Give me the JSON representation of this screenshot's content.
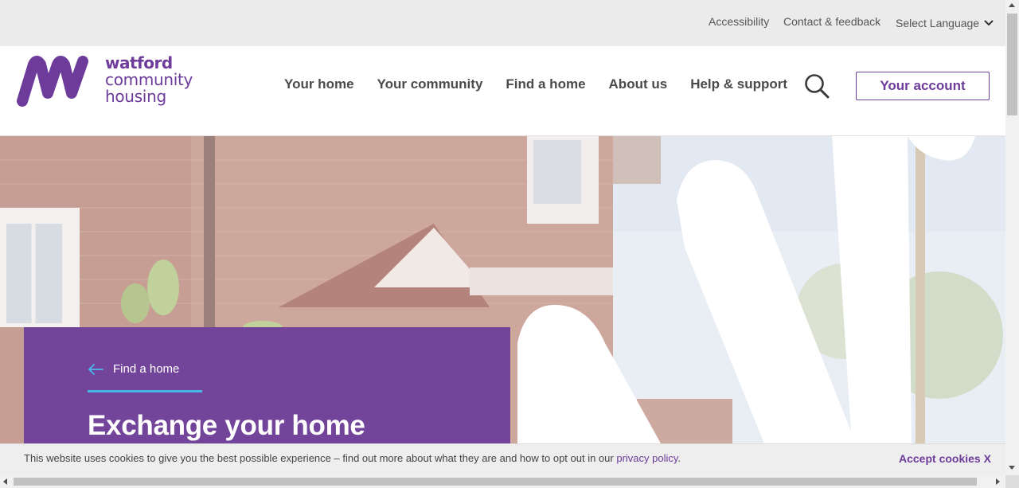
{
  "utility": {
    "accessibility": "Accessibility",
    "contact": "Contact & feedback",
    "language": "Select Language"
  },
  "logo": {
    "line1": "watford",
    "line2": "community",
    "line3": "housing"
  },
  "nav": {
    "items": [
      "Your home",
      "Your community",
      "Find a home",
      "About us",
      "Help & support"
    ]
  },
  "account": {
    "label": "Your account"
  },
  "hero": {
    "breadcrumb": "Find a home",
    "title": "Exchange your home"
  },
  "cookie": {
    "text": "This website uses cookies to give you the best possible experience – find out more about what they are and how to opt out in our ",
    "link": "privacy policy",
    "after": ".",
    "accept": "Accept cookies X"
  },
  "colors": {
    "brand": "#6d3c9b",
    "hero_card": "#72459b",
    "accent_line": "#4cb5e8"
  }
}
